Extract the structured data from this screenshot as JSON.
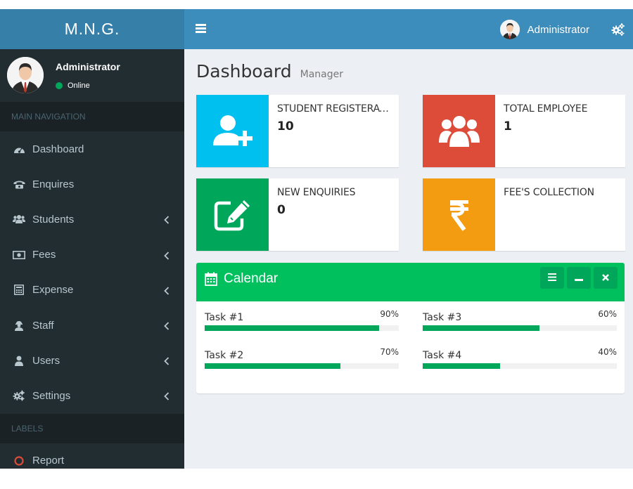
{
  "app": {
    "logo": "M.N.G."
  },
  "header": {
    "user_name": "Administrator",
    "icons": [
      "menu-icon",
      "cogs-icon"
    ]
  },
  "sidebar": {
    "user": {
      "name": "Administrator",
      "status": "Online"
    },
    "main_nav_header": "MAIN NAVIGATION",
    "items": [
      {
        "label": "Dashboard",
        "icon": "dashboard-icon",
        "has_children": false
      },
      {
        "label": "Enquires",
        "icon": "phone-icon",
        "has_children": false
      },
      {
        "label": "Students",
        "icon": "users-icon",
        "has_children": true
      },
      {
        "label": "Fees",
        "icon": "money-icon",
        "has_children": true
      },
      {
        "label": "Expense",
        "icon": "calculator-icon",
        "has_children": true
      },
      {
        "label": "Staff",
        "icon": "staff-icon",
        "has_children": true
      },
      {
        "label": "Users",
        "icon": "user-icon",
        "has_children": true
      },
      {
        "label": "Settings",
        "icon": "cogs-icon",
        "has_children": true
      }
    ],
    "labels_header": "LABELS",
    "label_items": [
      {
        "label": "Report",
        "icon": "circle-icon",
        "color": "#dd4b39"
      }
    ]
  },
  "page": {
    "title": "Dashboard",
    "subtitle": "Manager"
  },
  "info_boxes": [
    {
      "label": "STUDENT REGISTERATION",
      "value": "10",
      "color": "#00c0ef",
      "icon": "user-plus-icon"
    },
    {
      "label": "TOTAL EMPLOYEE",
      "value": "1",
      "color": "#dd4b39",
      "icon": "users-icon"
    },
    {
      "label": "NEW ENQUIRIES",
      "value": "0",
      "color": "#00a65a",
      "icon": "edit-icon"
    },
    {
      "label": "FEE'S COLLECTION",
      "value": "",
      "color": "#f39c12",
      "icon": "rupee-icon"
    }
  ],
  "calendar": {
    "title": "Calendar",
    "header_color": "#00c05e",
    "tools": [
      "bars-icon",
      "minus-icon",
      "times-icon"
    ],
    "tasks": [
      {
        "label": "Task #1",
        "percent_text": "90%",
        "progress": 0.9
      },
      {
        "label": "Task #3",
        "percent_text": "60%",
        "progress": 0.6
      },
      {
        "label": "Task #2",
        "percent_text": "70%",
        "progress": 0.7
      },
      {
        "label": "Task #4",
        "percent_text": "40%",
        "progress": 0.4
      }
    ]
  }
}
